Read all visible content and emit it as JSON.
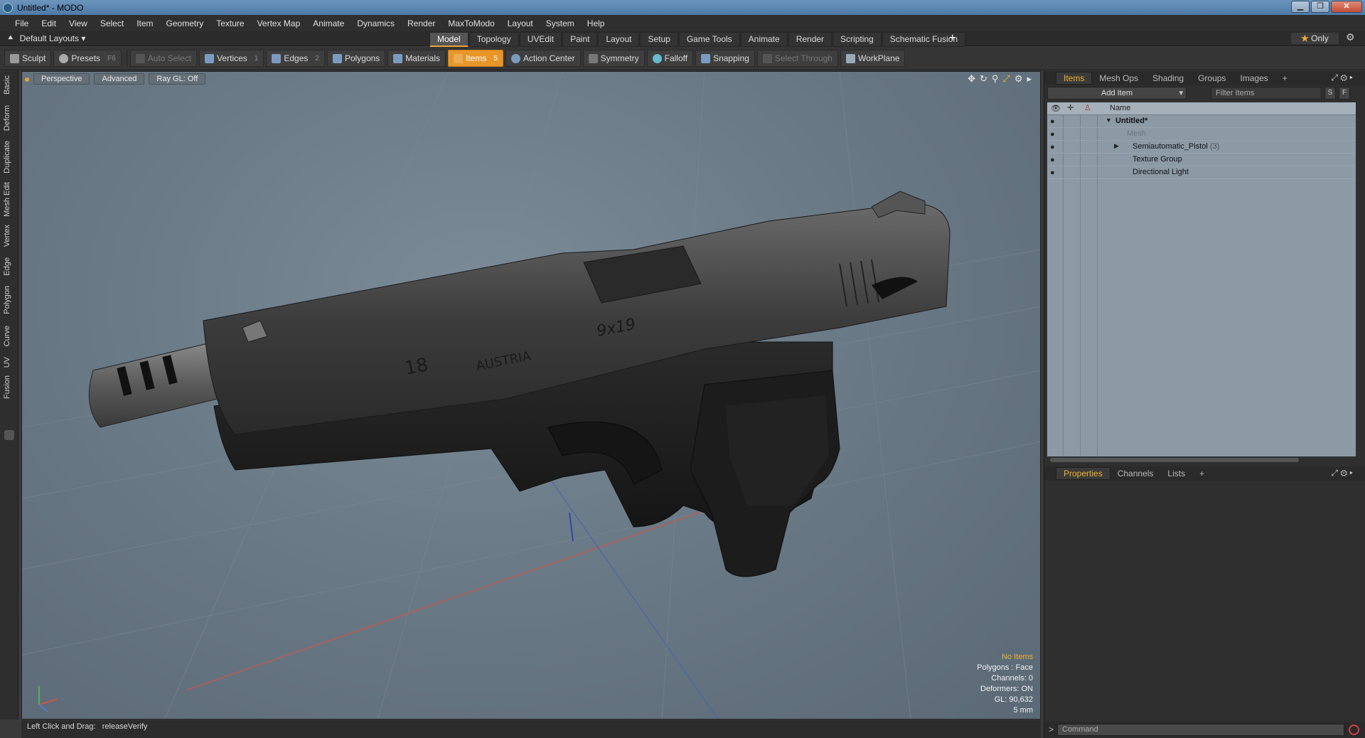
{
  "window": {
    "title": "Untitled* - MODO",
    "min": "▁",
    "max": "❐",
    "close": "✕"
  },
  "menu": [
    "File",
    "Edit",
    "View",
    "Select",
    "Item",
    "Geometry",
    "Texture",
    "Vertex Map",
    "Animate",
    "Dynamics",
    "Render",
    "MaxToModo",
    "Layout",
    "System",
    "Help"
  ],
  "layoutbar": {
    "layout_dropdown": "Default Layouts ▾",
    "tabs": [
      "Model",
      "Topology",
      "UVEdit",
      "Paint",
      "Layout",
      "Setup",
      "Game Tools",
      "Animate",
      "Render",
      "Scripting",
      "Schematic Fusion"
    ],
    "active_tab": "Model",
    "add": "+",
    "only_star": "★",
    "only": "Only"
  },
  "toolbar": {
    "sculpt": "Sculpt",
    "presets": "Presets",
    "presets_key": "F6",
    "auto_select": "Auto Select",
    "vertices": "Vertices",
    "vertices_key": "1",
    "edges": "Edges",
    "edges_key": "2",
    "polygons": "Polygons",
    "materials": "Materials",
    "items": "Items",
    "items_key": "5",
    "action_center": "Action Center",
    "symmetry": "Symmetry",
    "falloff": "Falloff",
    "snapping": "Snapping",
    "select_through": "Select Through",
    "workplane": "WorkPlane"
  },
  "left_tabs": [
    "Basic",
    "Deform",
    "Duplicate",
    "Mesh Edit",
    "Vertex",
    "Edge",
    "Polygon",
    "Curve",
    "UV",
    "Fusion"
  ],
  "viewport": {
    "view_mode": "Perspective",
    "shading": "Advanced",
    "raygl": "Ray GL: Off",
    "model_text": {
      "number": "18",
      "brand": "AUSTRIA",
      "caliber": "9x19"
    },
    "stats": {
      "selection": "No Items",
      "polygons": "Polygons : Face",
      "channels": "Channels: 0",
      "deformers": "Deformers: ON",
      "gl": "GL: 90,632",
      "grid": "5 mm"
    }
  },
  "status": {
    "hint": "Left Click and Drag:",
    "action": "releaseVerify"
  },
  "right_panel": {
    "tabs": [
      "Items",
      "Mesh Ops",
      "Shading",
      "Groups",
      "Images",
      "+"
    ],
    "active_tab": "Items",
    "add_item": "Add Item",
    "filter_placeholder": "Filter Items",
    "s_btn": "S",
    "f_btn": "F",
    "col_name": "Name",
    "tree": [
      {
        "label": "Untitled*",
        "bold": true
      },
      {
        "label": "Mesh",
        "dim": true
      },
      {
        "label": "Semiautomatic_Pistol",
        "count": "(3)"
      },
      {
        "label": "Texture Group"
      },
      {
        "label": "Directional Light"
      }
    ],
    "bottom_tabs": [
      "Properties",
      "Channels",
      "Lists",
      "+"
    ],
    "bottom_active": "Properties",
    "command_prompt": ">",
    "command_placeholder": "Command"
  },
  "colors": {
    "accent": "#e8962a",
    "viewport_bg": "#6a7a86",
    "tree_bg": "#8c9aa6"
  }
}
